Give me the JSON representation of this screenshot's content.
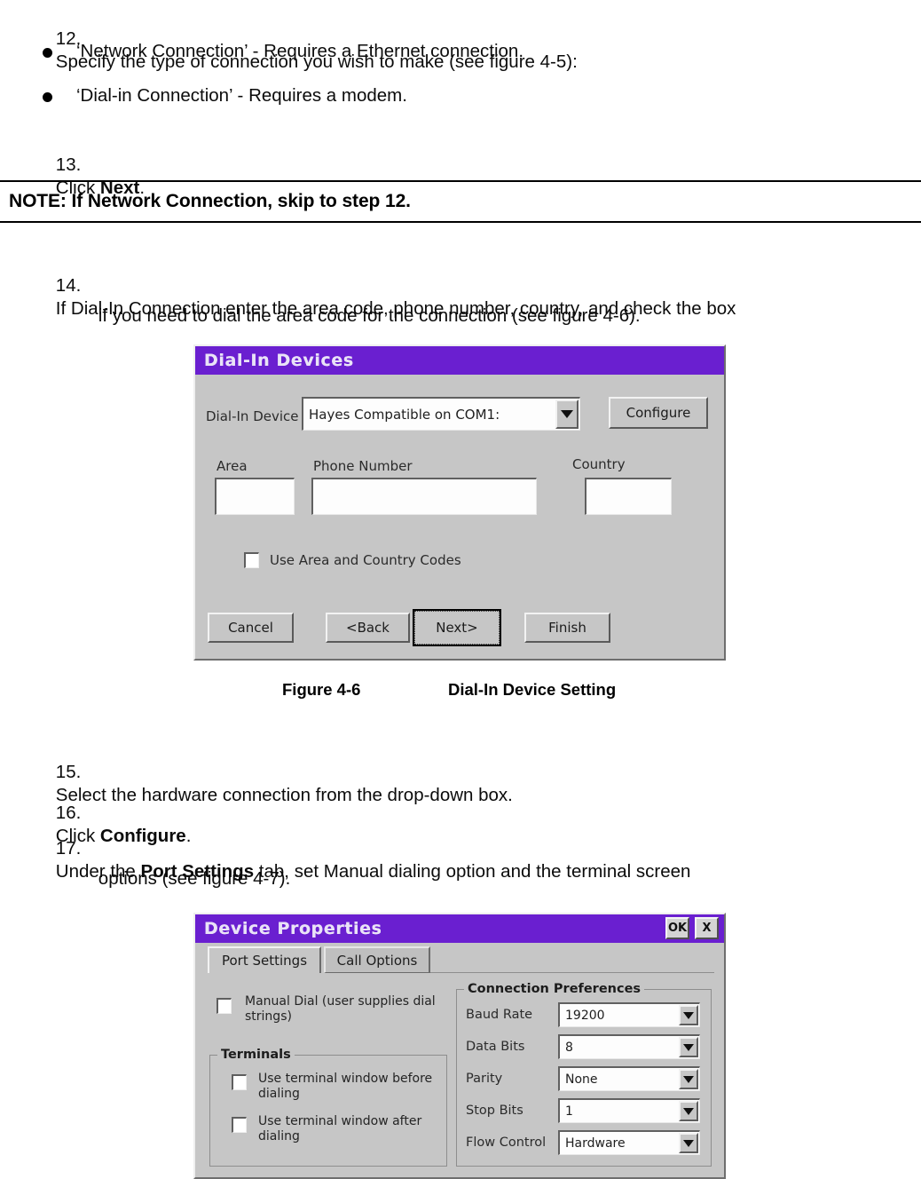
{
  "document": {
    "steps": [
      {
        "id": "step-12",
        "number": "12.",
        "text": "Specify the type of connection you wish to make (see figure 4-5):"
      },
      {
        "id": "step-13",
        "number": "13.",
        "pre": "Click ",
        "bold": "Next",
        "post": "."
      },
      {
        "id": "step-14",
        "number": "14.",
        "line1": "If Dial-In Connection enter the area code, phone number, country, and check the box",
        "line2": "if you need to dial the area code for the connection (see figure 4-6)."
      },
      {
        "id": "step-15",
        "number": "15.",
        "text": "Select the hardware connection from the drop-down box."
      },
      {
        "id": "step-16",
        "number": "16.",
        "pre": "Click ",
        "bold": "Configure",
        "post": "."
      },
      {
        "id": "step-17",
        "number": "17.",
        "pre": "Under the ",
        "bold": "Port Settings",
        "post": " tab, set Manual dialing option and the terminal screen",
        "line2": "options (see figure 4-7)."
      }
    ],
    "bullets": [
      {
        "id": "bullet-network",
        "text": "‘Network Connection’ - Requires a Ethernet connection."
      },
      {
        "id": "bullet-dialin",
        "text": "‘Dial-in Connection’ - Requires a modem."
      }
    ],
    "note": {
      "text": "NOTE: If Network Connection, skip to step 12."
    },
    "figure_caption": {
      "label": "Figure 4-6",
      "title": "Dial-In Device Setting"
    }
  },
  "dialog_dialin": {
    "title": "Dial-In Devices",
    "device_label": "Dial-In Device",
    "device_value": "Hayes Compatible on COM1:",
    "configure_button": "Configure",
    "area_label": "Area",
    "area_value": "",
    "phone_label": "Phone Number",
    "phone_value": "",
    "country_label": "Country",
    "country_value": "",
    "use_codes_label": "Use Area and Country Codes",
    "use_codes_checked": false,
    "buttons": {
      "cancel": "Cancel",
      "back": "<Back",
      "next": "Next>",
      "finish": "Finish"
    },
    "titlebar_color": "#6a1fd0",
    "face_color": "#c6c6c6"
  },
  "dialog_device_properties": {
    "title": "Device Properties",
    "titlebar_buttons": {
      "ok": "OK",
      "close": "X"
    },
    "tabs": [
      {
        "label": "Port Settings",
        "active": true
      },
      {
        "label": "Call Options",
        "active": false
      }
    ],
    "manual_dial": {
      "label_line1": "Manual Dial (user supplies dial",
      "label_line2": "strings)",
      "checked": false
    },
    "terminals_group": {
      "title": "Terminals",
      "options": [
        {
          "label_line1": "Use terminal window before",
          "label_line2": "dialing",
          "checked": false
        },
        {
          "label_line1": "Use terminal window after",
          "label_line2": "dialing",
          "checked": false
        }
      ]
    },
    "connection_preferences": {
      "title": "Connection Preferences",
      "fields": [
        {
          "label": "Baud Rate",
          "value": "19200"
        },
        {
          "label": "Data Bits",
          "value": "8"
        },
        {
          "label": "Parity",
          "value": "None"
        },
        {
          "label": "Stop Bits",
          "value": "1"
        },
        {
          "label": "Flow Control",
          "value": "Hardware"
        }
      ]
    },
    "titlebar_color": "#6a1fd0",
    "face_color": "#c6c6c6"
  }
}
